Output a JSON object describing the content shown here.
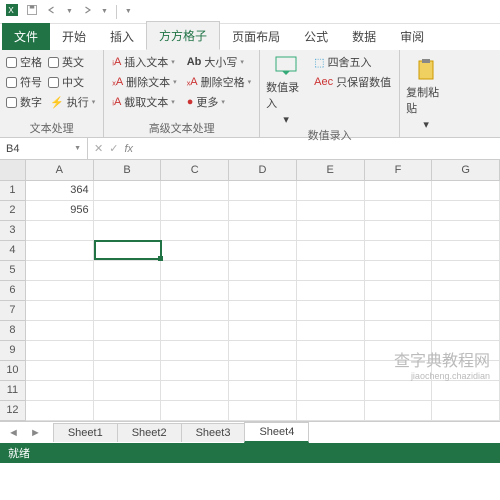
{
  "qat": {
    "title": ""
  },
  "tabs": {
    "file": "文件",
    "start": "开始",
    "insert": "插入",
    "fangfang": "方方格子",
    "layout": "页面布局",
    "formula": "公式",
    "data": "数据",
    "review": "审阅"
  },
  "ribbon": {
    "g1": {
      "space": "空格",
      "english": "英文",
      "symbol": "符号",
      "chinese": "中文",
      "number": "数字",
      "execute": "执行",
      "label": "文本处理"
    },
    "g2": {
      "insertText": "插入文本",
      "deleteText": "删除文本",
      "cutText": "截取文本",
      "caseSize": "大小写",
      "deleteSpace": "删除空格",
      "more": "更多",
      "label": "高级文本处理"
    },
    "g3": {
      "numInput": "数值录入",
      "round": "四舍五入",
      "keepNum": "只保留数值",
      "label": "数值录入"
    },
    "g4": {
      "paste": "复制粘贴"
    }
  },
  "namebox": {
    "cell": "B4"
  },
  "cols": [
    "A",
    "B",
    "C",
    "D",
    "E",
    "F",
    "G"
  ],
  "rows": [
    "1",
    "2",
    "3",
    "4",
    "5",
    "6",
    "7",
    "8",
    "9",
    "10",
    "11",
    "12"
  ],
  "cells": {
    "A1": "364",
    "A2": "956"
  },
  "sheets": {
    "s1": "Sheet1",
    "s2": "Sheet2",
    "s3": "Sheet3",
    "s4": "Sheet4"
  },
  "status": {
    "ready": "就绪"
  },
  "watermark": {
    "main": "查字典教程网",
    "sub": "jiaocheng.chazidian"
  }
}
